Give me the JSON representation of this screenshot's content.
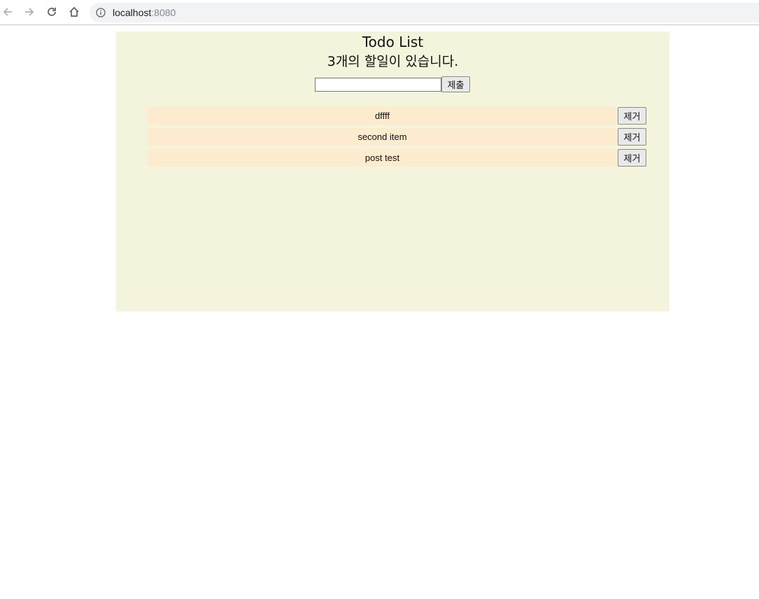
{
  "browser": {
    "url_host": "localhost",
    "url_port": ":8080",
    "icons": [
      "back-icon",
      "forward-icon",
      "reload-icon",
      "home-icon",
      "info-icon"
    ]
  },
  "app": {
    "title": "Todo List",
    "count_text": "3개의 할일이 있습니다.",
    "input_value": "",
    "submit_label": "제출",
    "items": [
      {
        "text": "dffff",
        "remove_label": "제거"
      },
      {
        "text": "second item",
        "remove_label": "제거"
      },
      {
        "text": "post test",
        "remove_label": "제거"
      }
    ]
  },
  "colors": {
    "panel_bg": "#f4f4dc",
    "item_bg": "#fdebcf"
  }
}
